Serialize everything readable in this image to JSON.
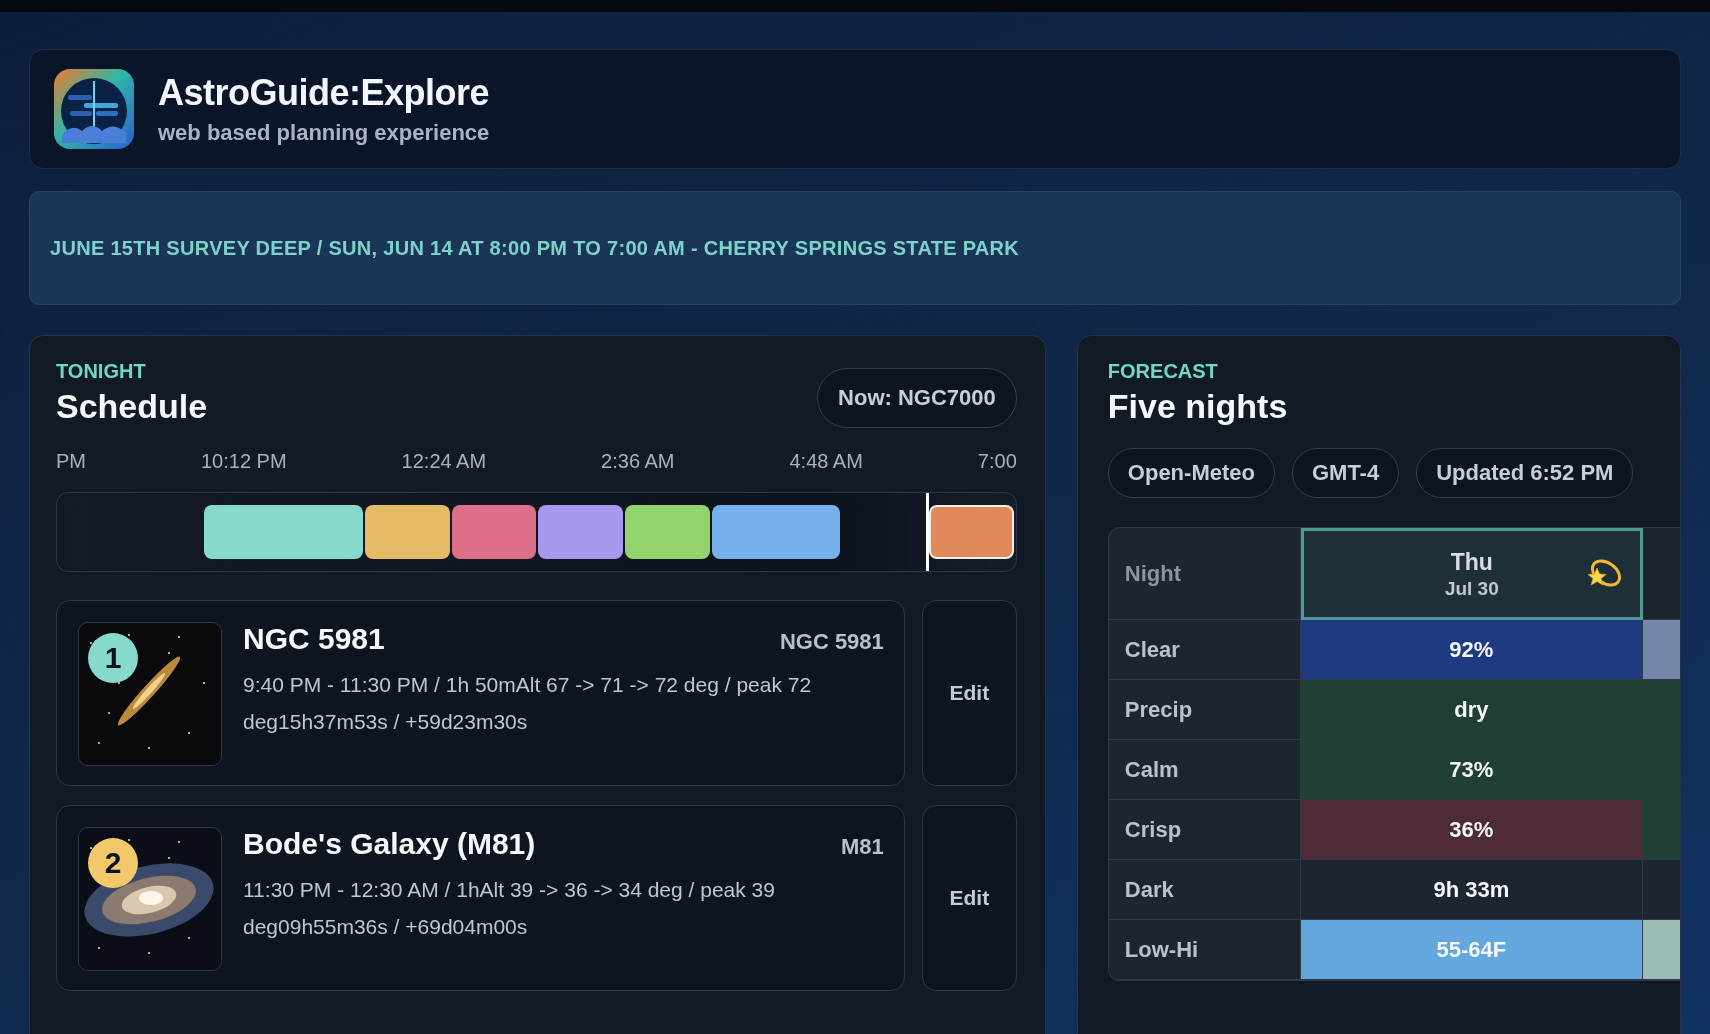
{
  "app": {
    "title": "AstroGuide:Explore",
    "subtitle": "web based planning experience"
  },
  "banner": "JUNE 15TH SURVEY DEEP / SUN, JUN 14 AT 8:00 PM TO 7:00 AM - CHERRY SPRINGS STATE PARK",
  "schedule": {
    "eyebrow": "TONIGHT",
    "title": "Schedule",
    "now": "Now: NGC7000",
    "axis_labels": [
      "PM",
      "10:12 PM",
      "12:24 AM",
      "2:36 AM",
      "4:48 AM",
      "7:00"
    ],
    "segments": [
      {
        "color": "#86d9cc",
        "selected": false
      },
      {
        "color": "#e5bb66",
        "selected": false
      },
      {
        "color": "#de6f88",
        "selected": false
      },
      {
        "color": "#a898ee",
        "selected": false
      },
      {
        "color": "#92d36e",
        "selected": false
      },
      {
        "color": "#76b1ee",
        "selected": false
      },
      {
        "color": "#e08a5a",
        "selected": true
      }
    ],
    "targets": [
      {
        "number": "1",
        "color": "#86d9cc",
        "name": "NGC 5981",
        "code": "NGC 5981",
        "detail": "9:40 PM - 11:30 PM / 1h 50mAlt 67 -> 71 -> 72 deg / peak 72 deg15h37m53s / +59d23m30s",
        "action": "Edit"
      },
      {
        "number": "2",
        "color": "#f2c86a",
        "name": "Bode's Galaxy (M81)",
        "code": "M81",
        "detail": "11:30 PM - 12:30 AM / 1hAlt 39 -> 36 -> 34 deg / peak 39 deg09h55m36s / +69d04m00s",
        "action": "Edit"
      }
    ]
  },
  "forecast": {
    "eyebrow": "FORECAST",
    "title": "Five nights",
    "sources": [
      "Open-Meteo",
      "GMT-4",
      "Updated 6:52 PM"
    ],
    "table": {
      "corner": "Night",
      "rows": [
        "Clear",
        "Precip",
        "Calm",
        "Crisp",
        "Dark",
        "Low-Hi"
      ],
      "nights": [
        {
          "day": "Thu",
          "date": "Jul 30",
          "selected": true,
          "cells": [
            {
              "value": "92%",
              "color": "#1f3a80"
            },
            {
              "value": "dry",
              "color": "#214034"
            },
            {
              "value": "73%",
              "color": "#214034"
            },
            {
              "value": "36%",
              "color": "#4e2c36"
            },
            {
              "value": "9h 33m",
              "color": "#1c2530"
            },
            {
              "value": "55-64F",
              "color": "#63a7dc"
            }
          ]
        },
        {
          "selected": false,
          "cells": [
            {
              "color": "#7585a8"
            },
            {
              "color": "#214034"
            },
            {
              "color": "#214034"
            },
            {
              "color": "#214034"
            },
            {
              "color": "#1c2530"
            },
            {
              "color": "#9cbcb8"
            }
          ]
        }
      ]
    }
  }
}
